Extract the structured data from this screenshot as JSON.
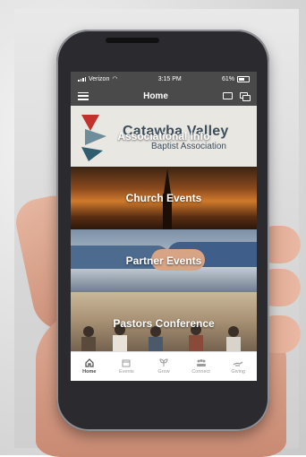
{
  "status_bar": {
    "carrier": "Verizon",
    "time": "3:15 PM",
    "battery": "61%"
  },
  "app_bar": {
    "title": "Home"
  },
  "tiles": [
    {
      "label": "Associational Info",
      "logo_line1": "Catawba Valley",
      "logo_line2": "Baptist Association"
    },
    {
      "label": "Church Events"
    },
    {
      "label": "Partner Events"
    },
    {
      "label": "Pastors Conference"
    }
  ],
  "bottom_nav": [
    {
      "label": "Home",
      "icon": "home-icon",
      "active": true
    },
    {
      "label": "Events",
      "icon": "calendar-icon",
      "active": false
    },
    {
      "label": "Grow",
      "icon": "sprout-icon",
      "active": false
    },
    {
      "label": "Connect",
      "icon": "people-icon",
      "active": false
    },
    {
      "label": "Giving",
      "icon": "giving-icon",
      "active": false
    }
  ],
  "colors": {
    "app_bar": "#4a4a4a",
    "logo_text": "#3d4f5c",
    "logo_red": "#c0322b",
    "logo_teal": "#2f5e6e"
  }
}
